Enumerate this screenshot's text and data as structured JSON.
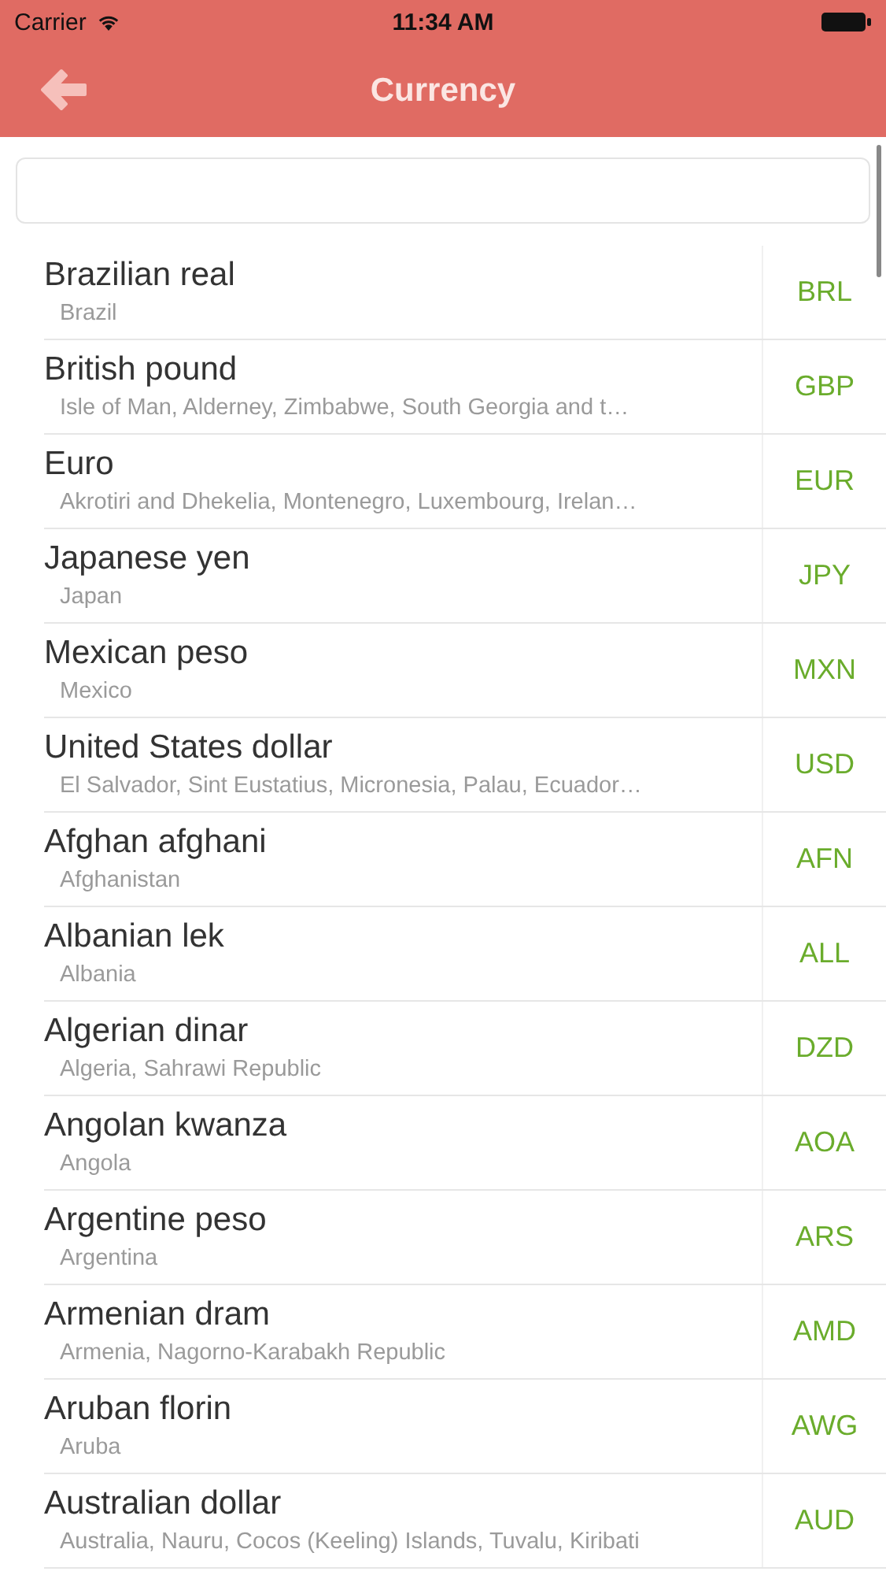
{
  "status_bar": {
    "carrier": "Carrier",
    "time": "11:34 AM"
  },
  "nav": {
    "title": "Currency"
  },
  "currencies": [
    {
      "name": "Brazilian real",
      "countries": "Brazil",
      "code": "BRL"
    },
    {
      "name": "British pound",
      "countries": "Isle of Man, Alderney, Zimbabwe, South Georgia and t…",
      "code": "GBP"
    },
    {
      "name": "Euro",
      "countries": "Akrotiri and Dhekelia, Montenegro, Luxembourg, Irelan…",
      "code": "EUR"
    },
    {
      "name": "Japanese yen",
      "countries": "Japan",
      "code": "JPY"
    },
    {
      "name": "Mexican peso",
      "countries": "Mexico",
      "code": "MXN"
    },
    {
      "name": "United States dollar",
      "countries": "El Salvador, Sint Eustatius, Micronesia, Palau, Ecuador…",
      "code": "USD"
    },
    {
      "name": "Afghan afghani",
      "countries": "Afghanistan",
      "code": "AFN"
    },
    {
      "name": "Albanian lek",
      "countries": "Albania",
      "code": "ALL"
    },
    {
      "name": "Algerian dinar",
      "countries": "Algeria, Sahrawi Republic",
      "code": "DZD"
    },
    {
      "name": "Angolan kwanza",
      "countries": "Angola",
      "code": "AOA"
    },
    {
      "name": "Argentine peso",
      "countries": "Argentina",
      "code": "ARS"
    },
    {
      "name": "Armenian dram",
      "countries": "Armenia, Nagorno-Karabakh Republic",
      "code": "AMD"
    },
    {
      "name": "Aruban florin",
      "countries": "Aruba",
      "code": "AWG"
    },
    {
      "name": "Australian dollar",
      "countries": "Australia, Nauru, Cocos (Keeling) Islands, Tuvalu, Kiribati",
      "code": "AUD"
    }
  ]
}
